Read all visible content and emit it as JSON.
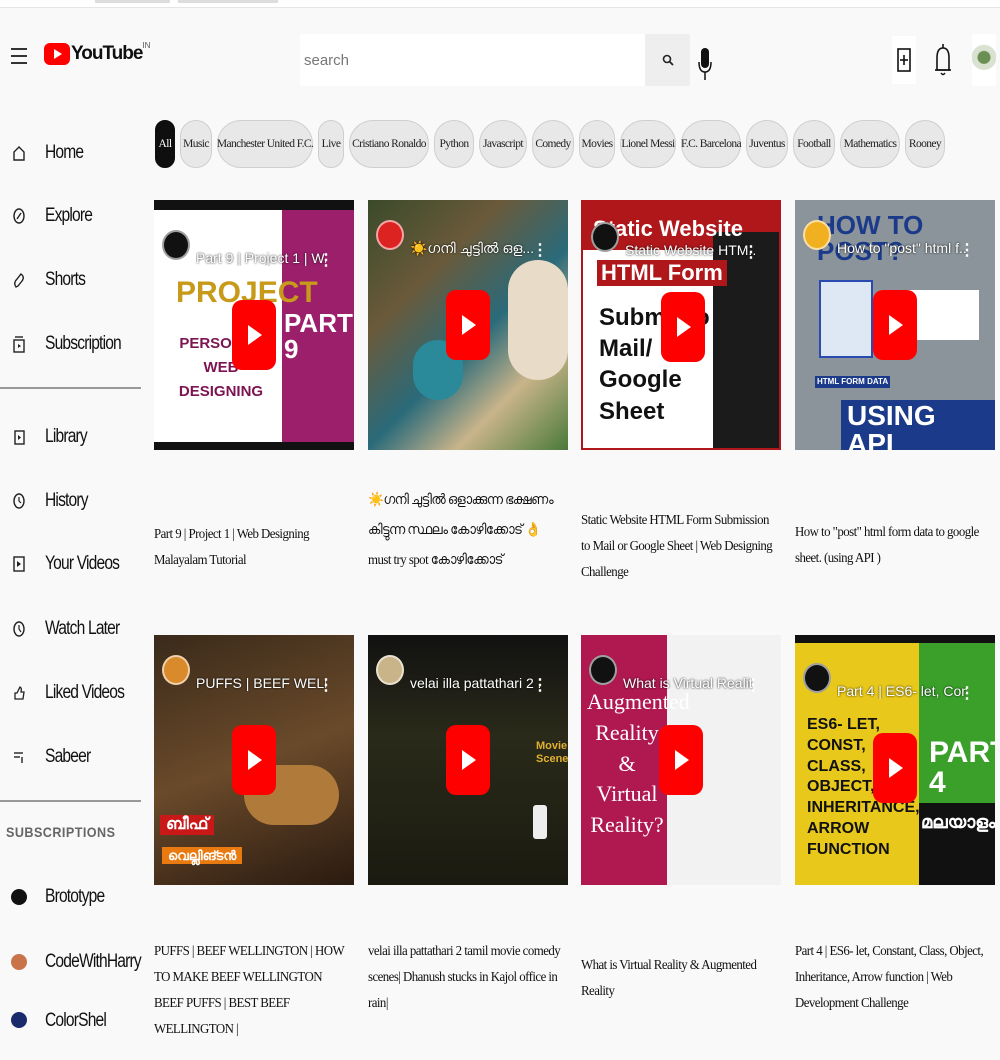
{
  "header": {
    "logo_text": "YouTube",
    "logo_region": "IN",
    "search_placeholder": "search"
  },
  "sidebar": {
    "items": [
      {
        "label": "Home",
        "icon": "home-icon"
      },
      {
        "label": "Explore",
        "icon": "compass-icon"
      },
      {
        "label": "Shorts",
        "icon": "shorts-icon"
      },
      {
        "label": "Subscription",
        "icon": "subscriptions-icon"
      },
      {
        "label": "Library",
        "icon": "library-icon"
      },
      {
        "label": "History",
        "icon": "history-icon"
      },
      {
        "label": "Your Videos",
        "icon": "your-videos-icon"
      },
      {
        "label": "Watch Later",
        "icon": "clock-icon"
      },
      {
        "label": "Liked Videos",
        "icon": "thumbs-up-icon"
      },
      {
        "label": "Sabeer",
        "icon": "playlist-icon"
      }
    ],
    "subscriptions_heading": "SUBSCRIPTIONS",
    "subscriptions": [
      {
        "label": "Brototype",
        "color": "#111111"
      },
      {
        "label": "CodeWithHarry",
        "color": "#c8734a"
      },
      {
        "label": "ColorShel",
        "color": "#1a2a6a"
      }
    ]
  },
  "chips": [
    "All",
    "Music",
    "Manchester United F.C.",
    "Live",
    "Cristiano Ronaldo",
    "Python",
    "Javascript",
    "Comedy",
    "Movies",
    "Lionel Messi",
    "F.C. Barcelona",
    "Juventus",
    "Football",
    "Mathematics",
    "Rooney"
  ],
  "videos": [
    {
      "overlay": "Part 9 | Project 1 | W...",
      "title": "Part 9 | Project 1 | Web Designing Malayalam Tutorial",
      "thumb_text_1": "PROJECT",
      "thumb_text_2": "PERSONAL WEB DESIGNING",
      "thumb_text_3": "PART 9"
    },
    {
      "overlay": "☀️ഗനി ചുട്ടിൽ ഒള...",
      "title": "☀️ഗനി ചുട്ടിൽ ഒളാക്കുന്ന ഭക്ഷണം കിട്ടുന്ന സ്ഥലം കോഴിക്കോട് 👌 must try spot കോഴിക്കോട്"
    },
    {
      "overlay": "Static Website HTM...",
      "title": "Static Website HTML Form Submission to Mail or Google Sheet | Web Designing Challenge",
      "thumb_text_1": "Static Website",
      "thumb_text_2": "HTML Form",
      "thumb_text_3": "Submit to Mail/ Google Sheet"
    },
    {
      "overlay": "How to \"post\" html f...",
      "title": "How to \"post\" html form data to google sheet. (using API )",
      "thumb_text_1": "HOW TO POST?",
      "thumb_text_2": "USING API",
      "thumb_text_3": "HTML FORM DATA"
    },
    {
      "overlay": "PUFFS | BEEF WELLI...",
      "title": "PUFFS | BEEF WELLINGTON | HOW TO MAKE BEEF WELLINGTON BEEF PUFFS | BEST BEEF WELLINGTON |",
      "thumb_text_1": "ബീഫ്",
      "thumb_text_2": "വെല്ലിങ്ടൻ"
    },
    {
      "overlay": "velai illa pattathari 2 ...",
      "title": "velai illa pattathari 2 tamil movie comedy scenes| Dhanush stucks in Kajol office in rain|",
      "thumb_text_1": "Movie Scenes"
    },
    {
      "overlay": "What is Virtual Realit...",
      "title": "What is Virtual Reality & Augmented Reality",
      "thumb_text_1": "Augmented Reality & Virtual Reality?"
    },
    {
      "overlay": "Part 4 | ES6- let, Con...",
      "title": "Part 4 | ES6- let, Constant, Class, Object, Inheritance, Arrow function | Web Development Challenge",
      "thumb_text_1": "ES6- LET, CONST, CLASS, OBJECT, INHERITANCE, ARROW FUNCTION",
      "thumb_text_2": "PART 4",
      "thumb_text_3": "മലയാളം"
    }
  ]
}
